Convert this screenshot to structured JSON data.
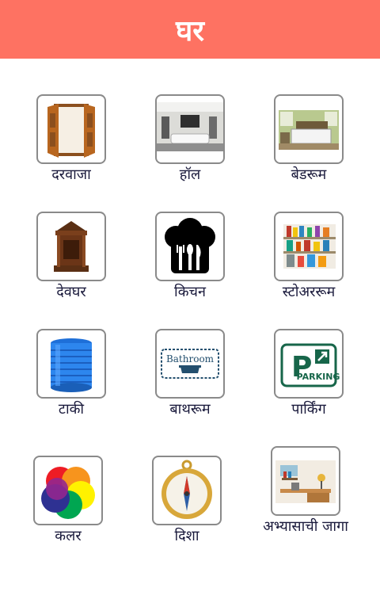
{
  "header": {
    "title": "घर"
  },
  "items": [
    {
      "label": "दरवाजा",
      "icon": "door-icon"
    },
    {
      "label": "हॉल",
      "icon": "living-room-icon"
    },
    {
      "label": "बेडरूम",
      "icon": "bedroom-icon"
    },
    {
      "label": "देवघर",
      "icon": "shrine-icon"
    },
    {
      "label": "किचन",
      "icon": "chef-hat-cutlery-icon"
    },
    {
      "label": "स्टोअररूम",
      "icon": "storeroom-shelves-icon"
    },
    {
      "label": "टाकी",
      "icon": "water-tank-icon"
    },
    {
      "label": "बाथरूम",
      "icon": "bathroom-sign-icon"
    },
    {
      "label": "पार्किंग",
      "icon": "parking-sign-icon"
    },
    {
      "label": "कलर",
      "icon": "color-circles-icon"
    },
    {
      "label": "दिशा",
      "icon": "compass-icon"
    },
    {
      "label": "अभ्यासाची जागा",
      "icon": "study-desk-icon"
    }
  ],
  "bathroom_sign_text": "Bathroom",
  "parking_sign_text": "PARKING",
  "colors": {
    "header": "#fe7262",
    "label": "#1a1a3c",
    "card_border": "#8a8a8a"
  }
}
